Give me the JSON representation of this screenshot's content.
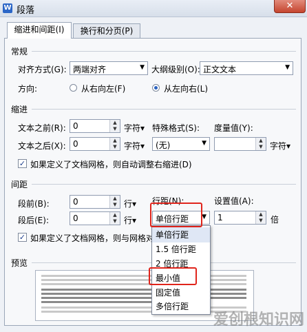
{
  "window": {
    "icon_letter": "W",
    "title": "段落",
    "close_glyph": "✕"
  },
  "tabs": [
    {
      "label": "缩进和间距(I)"
    },
    {
      "label": "换行和分页(P)"
    }
  ],
  "general": {
    "section_label": "常规",
    "alignment": {
      "label": "对齐方式(G):",
      "value": "两端对齐"
    },
    "outline": {
      "label": "大纲级别(O):",
      "value": "正文文本"
    },
    "direction": {
      "label": "方向:",
      "rtl_label": "从右向左(F)",
      "ltr_label": "从左向右(L)"
    }
  },
  "indent": {
    "section_label": "缩进",
    "before": {
      "label": "文本之前(R):",
      "value": "0",
      "unit": "字符▾"
    },
    "after": {
      "label": "文本之后(X):",
      "value": "0",
      "unit": "字符▾"
    },
    "special": {
      "label": "特殊格式(S):",
      "value": "(无)"
    },
    "measure": {
      "label": "度量值(Y):",
      "value": "",
      "unit": "字符▾"
    },
    "auto_adjust_label": "如果定义了文档网格，则自动调整右缩进(D)"
  },
  "spacing": {
    "section_label": "间距",
    "before": {
      "label": "段前(B):",
      "value": "0",
      "unit": "行▾"
    },
    "after": {
      "label": "段后(E):",
      "value": "0",
      "unit": "行▾"
    },
    "line": {
      "label": "行距(N):",
      "value": "单倍行距"
    },
    "setting": {
      "label": "设置值(A):",
      "value": "1",
      "unit": "倍"
    },
    "grid_snap_label": "如果定义了文档网格，则与网格对"
  },
  "line_spacing_options": [
    "单倍行距",
    "1.5 倍行距",
    "2 倍行距",
    "最小值",
    "固定值",
    "多倍行距"
  ],
  "preview": {
    "section_label": "预览"
  },
  "watermark": "爱创根知识网",
  "colors": {
    "highlight_box": "#e0241b",
    "radio_dot": "#2a62c0"
  }
}
